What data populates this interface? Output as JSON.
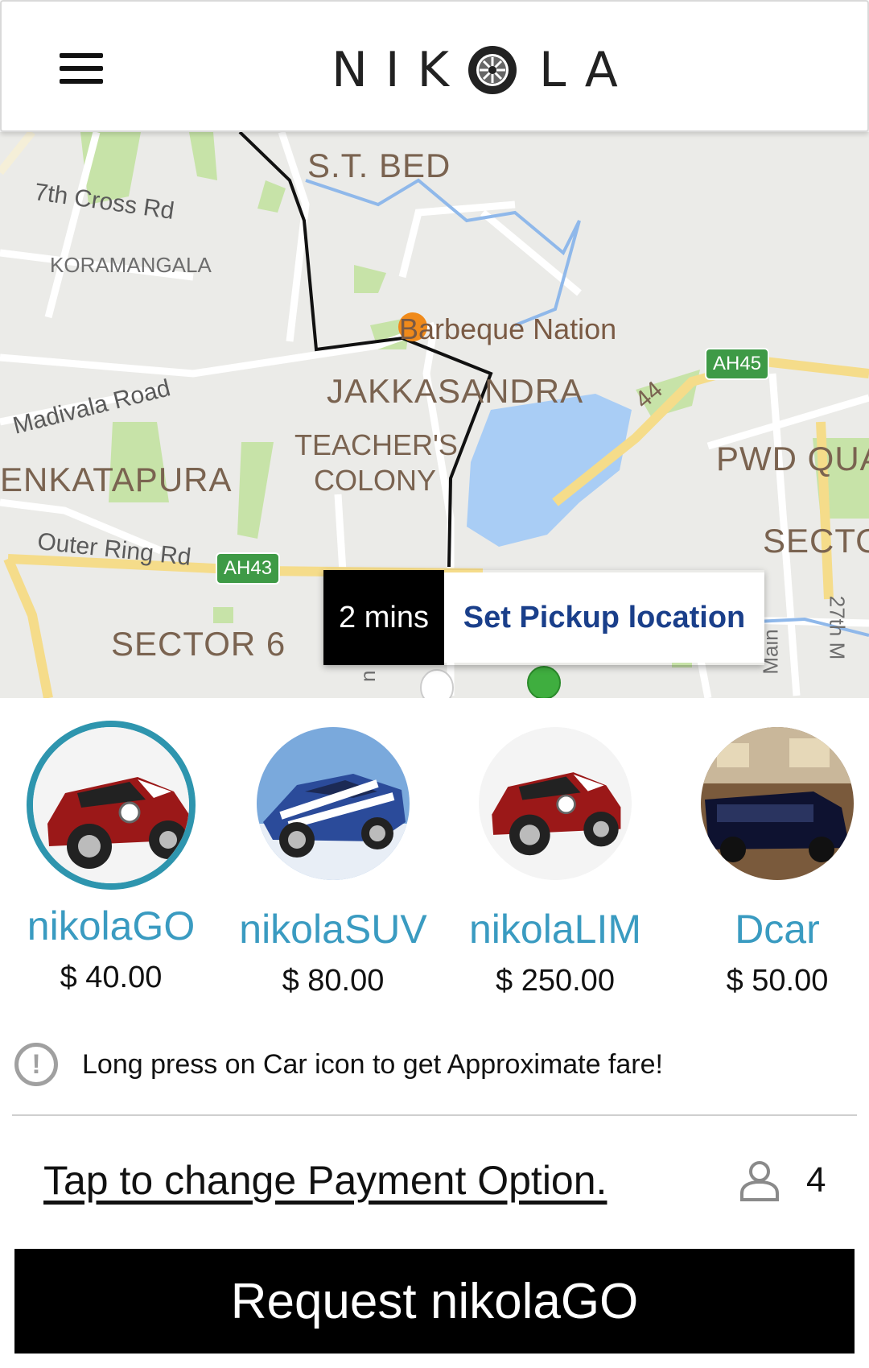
{
  "header": {
    "logo_left": "NIK",
    "logo_right": "LA",
    "menu_icon": "hamburger-menu-icon"
  },
  "map": {
    "labels": {
      "st_bed": "S.T. BED",
      "cross_rd": "7th Cross Rd",
      "koramangala": "KORAMANGALA",
      "restaurant": "Barbeque Nation",
      "jakkasandra": "JAKKASANDRA",
      "madivala": "Madivala Road",
      "teachers": "TEACHER'S",
      "colony": "COLONY",
      "venkatapura": "ENKATAPURA",
      "pwd": "PWD QUA",
      "outer_ring": "Outer Ring Rd",
      "sector6": "SECTOR 6",
      "sector": "SECTO",
      "hw44": "44",
      "ah45": "AH45",
      "ah43": "AH43",
      "main": "Main",
      "ro": "n Ro",
      "seventh": "27th M"
    },
    "pickup": {
      "eta": "2 mins",
      "label": "Set Pickup location"
    }
  },
  "cars": [
    {
      "name": "nikolaGO",
      "price": "$ 40.00",
      "selected": true,
      "image": "red-mini-cooper"
    },
    {
      "name": "nikolaSUV",
      "price": "$ 80.00",
      "selected": false,
      "image": "blue-sports-car"
    },
    {
      "name": "nikolaLIM",
      "price": "$ 250.00",
      "selected": false,
      "image": "red-mini-cooper"
    },
    {
      "name": "Dcar",
      "price": "$ 50.00",
      "selected": false,
      "image": "black-limousine-van"
    }
  ],
  "hint": {
    "icon": "exclamation-circle-icon",
    "text": "Long press on Car icon to get Approximate fare!"
  },
  "payment": {
    "label": "Tap to change Payment Option."
  },
  "seats": {
    "icon": "person-icon",
    "count": "4"
  },
  "request": {
    "label": "Request nikolaGO"
  },
  "colors": {
    "accent": "#2e95ae",
    "car_name": "#3a9bc1",
    "pickup_text": "#1a3f8a",
    "water": "#a9cdf5",
    "park": "#c7e3a8"
  }
}
